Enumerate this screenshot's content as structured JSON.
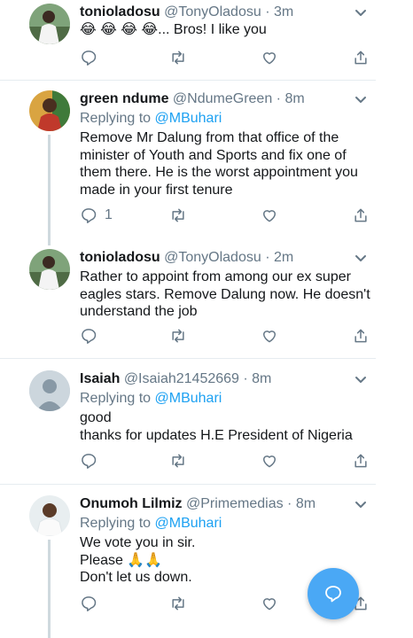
{
  "tweets": [
    {
      "name": "tonioladosu",
      "handle": "@TonyOladosu",
      "time": "3m",
      "reply_prefix": "",
      "reply_mention": "",
      "lines": [
        "😂 😂 😂 😂... Bros! I like you"
      ],
      "reply_count": ""
    },
    {
      "name": "green ndume",
      "handle": "@NdumeGreen",
      "time": "8m",
      "reply_prefix": "Replying to ",
      "reply_mention": "@MBuhari",
      "lines": [
        "Remove Mr Dalung from that office of the",
        "minister of Youth and Sports and fix one of",
        "them there. He is the worst appointment you",
        "made in your first tenure"
      ],
      "reply_count": "1"
    },
    {
      "name": "tonioladosu",
      "handle": "@TonyOladosu",
      "time": "2m",
      "reply_prefix": "",
      "reply_mention": "",
      "lines": [
        "Rather to appoint from among our ex super",
        "eagles stars. Remove Dalung now. He doesn't",
        "understand the job"
      ],
      "reply_count": ""
    },
    {
      "name": "Isaiah",
      "handle": "@Isaiah21452669",
      "time": "8m",
      "reply_prefix": "Replying to ",
      "reply_mention": "@MBuhari",
      "lines": [
        "good",
        "thanks for updates  H.E  President  of  Nigeria"
      ],
      "reply_count": ""
    },
    {
      "name": "Onumoh Lilmiz",
      "handle": "@Primemedias",
      "time": "8m",
      "reply_prefix": "Replying to ",
      "reply_mention": "@MBuhari",
      "lines": [
        "We vote you in sir.",
        "Please 🙏🙏",
        "Don't let us down."
      ],
      "reply_count": ""
    }
  ],
  "separator": " · ",
  "colors": {
    "accent": "#1da1f2",
    "secondary_text": "#657786",
    "fab": "#4aa8f5"
  },
  "icons": [
    "reply-icon",
    "retweet-icon",
    "like-icon",
    "share-icon",
    "chevron-down-icon",
    "compose-icon"
  ]
}
